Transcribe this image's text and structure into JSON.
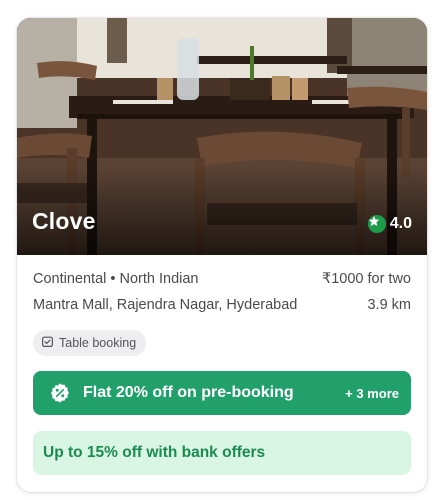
{
  "restaurant": {
    "name": "Clove",
    "rating": "4.0",
    "cuisines": "Continental • North Indian",
    "price": "₹1000 for two",
    "address": "Mantra Mall, Rajendra Nagar, Hyderabad",
    "distance": "3.9 km"
  },
  "tags": {
    "table_booking": "Table booking"
  },
  "offers": {
    "primary": "Flat 20% off on pre-booking",
    "more": "+ 3 more",
    "bank": "Up to 15% off with bank offers"
  },
  "colors": {
    "offer_green": "#22a06b",
    "bank_bg": "#d9f6e5",
    "bank_text": "#1c8a4f",
    "rating_green": "#1f9c4a"
  },
  "icons": {
    "rating": "star-icon",
    "table_booking": "calendar-check-icon",
    "offer": "discount-percent-icon"
  }
}
